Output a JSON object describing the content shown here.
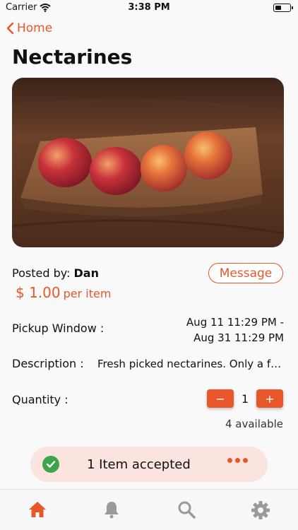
{
  "status_bar": {
    "carrier": "Carrier",
    "time": "3:38 PM"
  },
  "nav": {
    "back_label": "Home",
    "back_icon": "chevron-left-icon"
  },
  "product": {
    "title": "Nectarines",
    "posted_by_label": "Posted by:",
    "poster_name": "Dan",
    "price": "$ 1.00",
    "price_unit": "per item"
  },
  "message_button": {
    "label": "Message"
  },
  "details": {
    "pickup_label": "Pickup Window :",
    "pickup_start": "Aug 11  11:29 PM -",
    "pickup_end": "Aug 31  11:29 PM",
    "description_label": "Description :",
    "description_value": "Fresh picked nectarines. Only a few left this season.",
    "quantity_label": "Quantity :",
    "quantity_value": "1",
    "decrement": "−",
    "increment": "+",
    "available": "4 available"
  },
  "banner": {
    "text": "1 Item accepted"
  },
  "tabbar": {
    "items": [
      {
        "icon": "home-icon",
        "active": true
      },
      {
        "icon": "bell-icon",
        "active": false
      },
      {
        "icon": "search-icon",
        "active": false
      },
      {
        "icon": "gear-icon",
        "active": false
      }
    ]
  },
  "colors": {
    "accent": "#e8572a",
    "success": "#3aa54a",
    "banner_bg": "#fbe3df",
    "inactive_icon": "#9a9a9a"
  }
}
